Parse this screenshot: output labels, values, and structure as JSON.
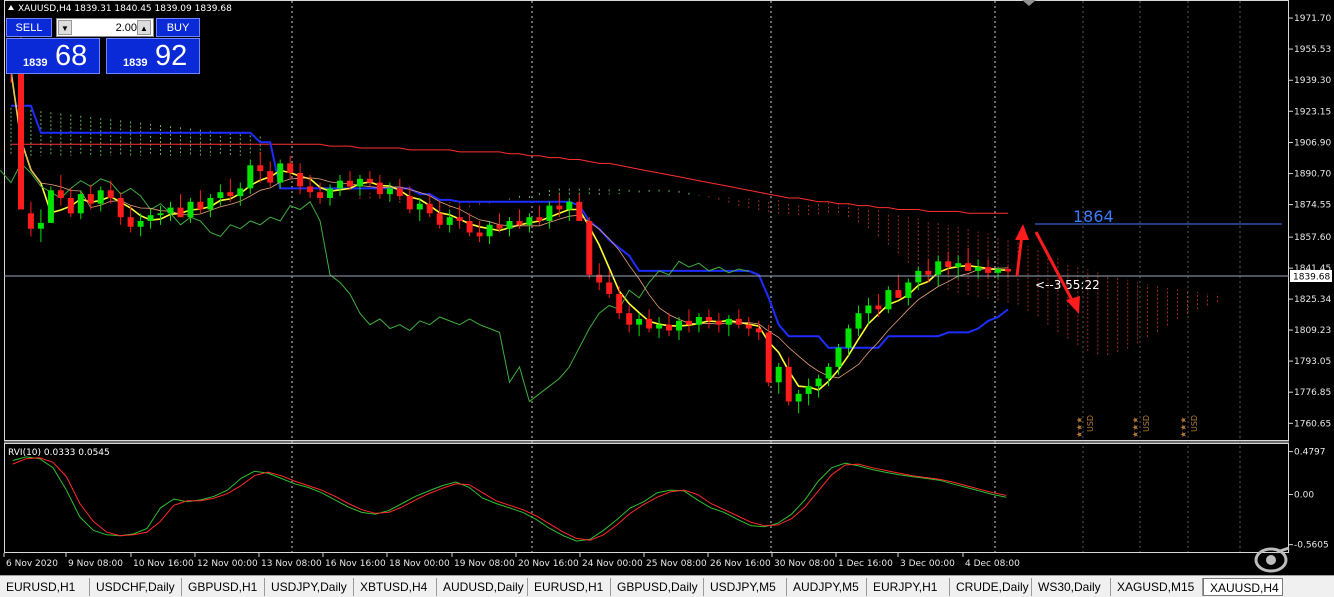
{
  "header": {
    "main_title": "XAUUSD,H4  1839.31 1840.45 1839.09 1839.68",
    "rvi_title": "RVI(10) 0.0333 0.0545"
  },
  "trade_panel": {
    "sell_label": "SELL",
    "buy_label": "BUY",
    "lot_value": "2.00",
    "sell_small": "1839",
    "sell_big": "68",
    "buy_small": "1839",
    "buy_big": "92"
  },
  "annotations": {
    "target_label": "1864",
    "countdown_label": "<--3 55:22",
    "current_price_label": "1839.68"
  },
  "calendar_events": [
    {
      "stars": "★★★",
      "currency": "USD"
    },
    {
      "stars": "★★★",
      "currency": "USD"
    },
    {
      "stars": "★★★",
      "currency": "USD"
    }
  ],
  "colors": {
    "bull": "#00e400",
    "bear": "#ff1c1c",
    "kijun": "#1d2dff",
    "tenkan": "#ffff33",
    "sma": "#ff2f2f",
    "chikou": "#3fae3f",
    "kumo_bull": "#6fd66f",
    "kumo_bear": "#c0332e",
    "target": "#3d7bff"
  },
  "chart_data": [
    {
      "type": "candlestick",
      "symbol": "XAUUSD",
      "timeframe": "H4",
      "ylim": [
        1753,
        1979
      ],
      "y_ticks": [
        "1971.70",
        "1955.53",
        "1939.30",
        "1923.15",
        "1906.90",
        "1890.70",
        "1874.55",
        "1857.60",
        "1841.45",
        "1825.34",
        "1809.23",
        "1793.05",
        "1776.85",
        "1760.65"
      ],
      "x_ticks": [
        "6 Nov 2020",
        "9 Nov 08:00",
        "10 Nov 16:00",
        "12 Nov 00:00",
        "13 Nov 08:00",
        "16 Nov 16:00",
        "18 Nov 00:00",
        "19 Nov 08:00",
        "20 Nov 16:00",
        "24 Nov 00:00",
        "25 Nov 08:00",
        "26 Nov 16:00",
        "30 Nov 08:00",
        "1 Dec 16:00",
        "3 Dec 00:00",
        "4 Dec 08:00"
      ],
      "last_price": 1839.68,
      "target_level": 1864,
      "candles_ohlc": [
        [
          1946,
          1948,
          1938,
          1944
        ],
        [
          1944,
          1962,
          1880,
          1872
        ],
        [
          1870,
          1876,
          1858,
          1862
        ],
        [
          1862,
          1872,
          1855,
          1865
        ],
        [
          1865,
          1884,
          1866,
          1882
        ],
        [
          1882,
          1890,
          1874,
          1878
        ],
        [
          1878,
          1883,
          1868,
          1870
        ],
        [
          1870,
          1882,
          1867,
          1880
        ],
        [
          1880,
          1885,
          1872,
          1875
        ],
        [
          1875,
          1884,
          1871,
          1882
        ],
        [
          1882,
          1887,
          1875,
          1878
        ],
        [
          1878,
          1881,
          1864,
          1868
        ],
        [
          1868,
          1874,
          1860,
          1863
        ],
        [
          1863,
          1870,
          1858,
          1866
        ],
        [
          1866,
          1872,
          1862,
          1869
        ],
        [
          1869,
          1874,
          1864,
          1870
        ],
        [
          1870,
          1876,
          1866,
          1873
        ],
        [
          1873,
          1880,
          1868,
          1868
        ],
        [
          1868,
          1878,
          1865,
          1876
        ],
        [
          1876,
          1882,
          1870,
          1872
        ],
        [
          1872,
          1880,
          1868,
          1878
        ],
        [
          1878,
          1885,
          1874,
          1881
        ],
        [
          1881,
          1888,
          1876,
          1879
        ],
        [
          1879,
          1886,
          1874,
          1883
        ],
        [
          1883,
          1898,
          1880,
          1895
        ],
        [
          1895,
          1902,
          1886,
          1892
        ],
        [
          1892,
          1897,
          1884,
          1886
        ],
        [
          1886,
          1898,
          1883,
          1896
        ],
        [
          1896,
          1900,
          1888,
          1891
        ],
        [
          1891,
          1896,
          1880,
          1884
        ],
        [
          1884,
          1890,
          1878,
          1881
        ],
        [
          1881,
          1886,
          1875,
          1878
        ],
        [
          1878,
          1885,
          1874,
          1883
        ],
        [
          1883,
          1890,
          1879,
          1887
        ],
        [
          1887,
          1892,
          1882,
          1884
        ],
        [
          1884,
          1890,
          1879,
          1888
        ],
        [
          1888,
          1892,
          1884,
          1886
        ],
        [
          1886,
          1890,
          1878,
          1880
        ],
        [
          1880,
          1886,
          1876,
          1883
        ],
        [
          1883,
          1888,
          1877,
          1879
        ],
        [
          1879,
          1884,
          1870,
          1872
        ],
        [
          1872,
          1878,
          1866,
          1875
        ],
        [
          1875,
          1880,
          1868,
          1870
        ],
        [
          1870,
          1876,
          1862,
          1864
        ],
        [
          1864,
          1872,
          1860,
          1868
        ],
        [
          1868,
          1874,
          1862,
          1866
        ],
        [
          1866,
          1870,
          1858,
          1860
        ],
        [
          1860,
          1866,
          1855,
          1858
        ],
        [
          1858,
          1866,
          1854,
          1864
        ],
        [
          1864,
          1870,
          1860,
          1862
        ],
        [
          1862,
          1868,
          1858,
          1866
        ],
        [
          1866,
          1872,
          1862,
          1864
        ],
        [
          1864,
          1870,
          1860,
          1868
        ],
        [
          1868,
          1874,
          1864,
          1866
        ],
        [
          1866,
          1876,
          1862,
          1874
        ],
        [
          1874,
          1880,
          1868,
          1872
        ],
        [
          1872,
          1878,
          1866,
          1876
        ],
        [
          1876,
          1880,
          1866,
          1866
        ],
        [
          1866,
          1868,
          1836,
          1838
        ],
        [
          1838,
          1844,
          1830,
          1834
        ],
        [
          1834,
          1840,
          1826,
          1828
        ],
        [
          1828,
          1832,
          1815,
          1818
        ],
        [
          1818,
          1822,
          1808,
          1812
        ],
        [
          1812,
          1818,
          1806,
          1815
        ],
        [
          1815,
          1820,
          1808,
          1810
        ],
        [
          1810,
          1816,
          1805,
          1812
        ],
        [
          1812,
          1818,
          1806,
          1809
        ],
        [
          1809,
          1816,
          1804,
          1814
        ],
        [
          1814,
          1820,
          1808,
          1812
        ],
        [
          1812,
          1818,
          1808,
          1816
        ],
        [
          1816,
          1820,
          1810,
          1814
        ],
        [
          1814,
          1818,
          1808,
          1812
        ],
        [
          1812,
          1817,
          1806,
          1815
        ],
        [
          1815,
          1820,
          1810,
          1812
        ],
        [
          1812,
          1816,
          1806,
          1810
        ],
        [
          1810,
          1814,
          1804,
          1808
        ],
        [
          1808,
          1812,
          1780,
          1782
        ],
        [
          1782,
          1792,
          1776,
          1790
        ],
        [
          1790,
          1795,
          1770,
          1772
        ],
        [
          1772,
          1778,
          1766,
          1776
        ],
        [
          1776,
          1784,
          1770,
          1780
        ],
        [
          1780,
          1786,
          1774,
          1784
        ],
        [
          1784,
          1792,
          1780,
          1790
        ],
        [
          1790,
          1802,
          1786,
          1800
        ],
        [
          1800,
          1812,
          1796,
          1810
        ],
        [
          1810,
          1822,
          1806,
          1818
        ],
        [
          1818,
          1826,
          1812,
          1822
        ],
        [
          1822,
          1828,
          1816,
          1820
        ],
        [
          1820,
          1832,
          1818,
          1830
        ],
        [
          1830,
          1838,
          1826,
          1826
        ],
        [
          1826,
          1836,
          1822,
          1834
        ],
        [
          1834,
          1842,
          1830,
          1840
        ],
        [
          1840,
          1846,
          1834,
          1838
        ],
        [
          1838,
          1848,
          1832,
          1845
        ],
        [
          1845,
          1850,
          1838,
          1842
        ],
        [
          1842,
          1848,
          1836,
          1844
        ],
        [
          1844,
          1852,
          1840,
          1840
        ],
        [
          1840,
          1846,
          1836,
          1842
        ],
        [
          1842,
          1846,
          1836,
          1839
        ],
        [
          1839,
          1842,
          1836,
          1841
        ],
        [
          1841,
          1843,
          1837,
          1839.68
        ]
      ],
      "kijun": [
        1926,
        1926,
        1926,
        1912,
        1912,
        1912,
        1912,
        1912,
        1912,
        1912,
        1912,
        1912,
        1912,
        1912,
        1912,
        1912,
        1912,
        1912,
        1912,
        1912,
        1912,
        1912,
        1912,
        1912,
        1912,
        1907,
        1907,
        1883,
        1883,
        1883,
        1883,
        1883,
        1883,
        1883,
        1883,
        1883,
        1883,
        1883,
        1883,
        1883,
        1883,
        1880,
        1880,
        1877,
        1877,
        1876,
        1876,
        1876,
        1876,
        1876,
        1876,
        1876,
        1876,
        1876,
        1876,
        1876,
        1876,
        1874,
        1866,
        1862,
        1856,
        1852,
        1848,
        1840,
        1840,
        1840,
        1840,
        1840,
        1840,
        1840,
        1840,
        1840,
        1840,
        1840,
        1840,
        1838,
        1826,
        1812,
        1806,
        1806,
        1806,
        1806,
        1800,
        1800,
        1800,
        1800,
        1800,
        1800,
        1806,
        1806,
        1806,
        1806,
        1806,
        1806,
        1808,
        1808,
        1808,
        1810,
        1814,
        1816,
        1820
      ],
      "sma": [
        1906,
        1906,
        1906,
        1906,
        1906,
        1906,
        1906,
        1906,
        1906,
        1906,
        1906,
        1906,
        1906,
        1906,
        1906,
        1906,
        1906,
        1906,
        1906,
        1906,
        1906,
        1906,
        1906,
        1906,
        1906,
        1906,
        1906,
        1906,
        1906,
        1906,
        1906,
        1906,
        1905,
        1905,
        1905,
        1904,
        1904,
        1904,
        1904,
        1904,
        1903,
        1903,
        1903,
        1903,
        1903,
        1902,
        1902,
        1902,
        1902,
        1902,
        1901,
        1901,
        1900,
        1900,
        1899,
        1899,
        1898,
        1898,
        1897,
        1896,
        1896,
        1895,
        1894,
        1893,
        1892,
        1891,
        1890,
        1889,
        1888,
        1887,
        1886,
        1885,
        1884,
        1883,
        1882,
        1881,
        1880,
        1879,
        1878,
        1878,
        1877,
        1876,
        1876,
        1875,
        1875,
        1874,
        1874,
        1873,
        1873,
        1872,
        1872,
        1872,
        1871,
        1871,
        1871,
        1871,
        1870,
        1870,
        1870,
        1870,
        1870
      ]
    },
    {
      "type": "line",
      "title": "RVI(10) 0.0333 0.0545",
      "ylim": [
        -0.62,
        0.52
      ],
      "y_ticks": [
        "0.4797",
        "0.00",
        "-0.5605"
      ],
      "series": [
        {
          "values": [
            0.38,
            0.42,
            0.4,
            0.3,
            0.05,
            -0.25,
            -0.4,
            -0.45,
            -0.46,
            -0.44,
            -0.38,
            -0.15,
            -0.05,
            -0.08,
            -0.06,
            -0.02,
            0.05,
            0.18,
            0.26,
            0.24,
            0.18,
            0.12,
            0.08,
            0.02,
            -0.06,
            -0.14,
            -0.2,
            -0.22,
            -0.18,
            -0.1,
            -0.02,
            0.04,
            0.1,
            0.14,
            0.08,
            -0.04,
            -0.1,
            -0.15,
            -0.2,
            -0.28,
            -0.38,
            -0.46,
            -0.52,
            -0.5,
            -0.4,
            -0.28,
            -0.15,
            -0.08,
            0.02,
            0.05,
            0.04,
            -0.06,
            -0.15,
            -0.2,
            -0.28,
            -0.35,
            -0.36,
            -0.32,
            -0.22,
            -0.06,
            0.15,
            0.3,
            0.35,
            0.32,
            0.28,
            0.25,
            0.22,
            0.2,
            0.18,
            0.16,
            0.12,
            0.08,
            0.04,
            0.0,
            -0.03
          ]
        },
        {
          "values": [
            0.34,
            0.4,
            0.41,
            0.36,
            0.2,
            -0.1,
            -0.3,
            -0.42,
            -0.46,
            -0.45,
            -0.42,
            -0.3,
            -0.12,
            -0.07,
            -0.07,
            -0.04,
            0.01,
            0.1,
            0.21,
            0.25,
            0.21,
            0.15,
            0.1,
            0.05,
            -0.02,
            -0.1,
            -0.17,
            -0.21,
            -0.2,
            -0.14,
            -0.06,
            0.01,
            0.07,
            0.12,
            0.11,
            0.02,
            -0.07,
            -0.12,
            -0.17,
            -0.24,
            -0.33,
            -0.42,
            -0.49,
            -0.51,
            -0.45,
            -0.34,
            -0.21,
            -0.11,
            -0.03,
            0.03,
            0.05,
            0.0,
            -0.1,
            -0.17,
            -0.24,
            -0.31,
            -0.35,
            -0.34,
            -0.27,
            -0.14,
            0.04,
            0.22,
            0.33,
            0.34,
            0.3,
            0.27,
            0.24,
            0.21,
            0.19,
            0.17,
            0.14,
            0.1,
            0.06,
            0.02,
            -0.01
          ]
        }
      ]
    }
  ],
  "tabs": [
    {
      "label": "EURUSD,H1",
      "active": false
    },
    {
      "label": "USDCHF,Daily",
      "active": false
    },
    {
      "label": "GBPUSD,H1",
      "active": false
    },
    {
      "label": "USDJPY,Daily",
      "active": false
    },
    {
      "label": "XBTUSD,H4",
      "active": false
    },
    {
      "label": "AUDUSD,Daily",
      "active": false
    },
    {
      "label": "EURUSD,H1",
      "active": false
    },
    {
      "label": "GBPUSD,Daily",
      "active": false
    },
    {
      "label": "USDJPY,M5",
      "active": false
    },
    {
      "label": "AUDJPY,M5",
      "active": false
    },
    {
      "label": "EURJPY,H1",
      "active": false
    },
    {
      "label": "CRUDE,Daily",
      "active": false
    },
    {
      "label": "WS30,Daily",
      "active": false
    },
    {
      "label": "XAGUSD,M15",
      "active": false
    },
    {
      "label": "XAUUSD,H4",
      "active": true
    }
  ]
}
